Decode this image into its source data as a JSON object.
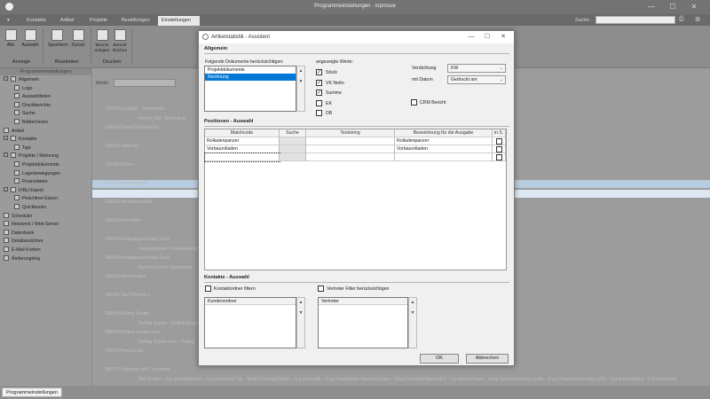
{
  "app": {
    "title": "Programmeinstellungen - inprosue"
  },
  "search": {
    "label": "Suche:"
  },
  "menu": {
    "tabs": [
      "Kontakte",
      "Artikel",
      "Projekte",
      "Bestellungen",
      "Einstellungen"
    ]
  },
  "ribbon": {
    "buttons": [
      "Alle",
      "Auswahl",
      "Speichern",
      "Zurück",
      "Bericht\nanlegen",
      "Bericht\nlöschen"
    ],
    "groups": [
      "Anzeige",
      "Bearbeiten",
      "Drucken"
    ]
  },
  "left": {
    "header": "Programmeinstellungen",
    "items": [
      {
        "label": "Allgemein",
        "level": 0,
        "expander": "⊟"
      },
      {
        "label": "Logo",
        "level": 1
      },
      {
        "label": "Auswahllisten",
        "level": 1
      },
      {
        "label": "Druckberichte",
        "level": 1
      },
      {
        "label": "Suche",
        "level": 1
      },
      {
        "label": "Bildrechnern",
        "level": 1
      },
      {
        "label": "Artikel",
        "level": 0
      },
      {
        "label": "Kontakte",
        "level": 0,
        "expander": "⊟"
      },
      {
        "label": "Tapi",
        "level": 1
      },
      {
        "label": "Projekte / Mahnung",
        "level": 0,
        "expander": "⊟"
      },
      {
        "label": "Projektdokumente",
        "level": 1
      },
      {
        "label": "Lagerbewegungen",
        "level": 1
      },
      {
        "label": "Finanzdaten",
        "level": 1
      },
      {
        "label": "FIBU Export",
        "level": 0,
        "expander": "⊟"
      },
      {
        "label": "Peachtree Export",
        "level": 1
      },
      {
        "label": "Quickbooks",
        "level": 1
      },
      {
        "label": "Scheduler",
        "level": 0
      },
      {
        "label": "Netzwerk / Web-Server",
        "level": 0
      },
      {
        "label": "Datenbank",
        "level": 0
      },
      {
        "label": "Detailansichten",
        "level": 0
      },
      {
        "label": "E-Mail Konten",
        "level": 0
      },
      {
        "label": "Änderungslog",
        "level": 0
      }
    ]
  },
  "main": {
    "modul_label": "Modul",
    "rows": [
      "100000   Kontakte - Telefonliste",
      "Permit_Kon_Telefonliste",
      "100100   Demo Druckbericht",
      "",
      "100200   Total Info",
      "",
      "100300   Demo",
      "",
      "200000   Artikelstatistik",
      "",
      "200100   Vorkaufsstatistik",
      "",
      "200200   Artikelliste",
      "",
      "300000   Fertigungsaufträge Serie",
      "Rundschlüssel Vorkaufsstatistik",
      "300100   Fertigungsaufträge Serie",
      "Rundschlüssel - Kabelsalat",
      "300200   Rechnungen",
      "",
      "300300   Text Themen 1",
      "",
      "300400   Rolling Shutter",
      "Rolling Shutter - Rolling Shutter",
      "300500   Rolling Shutter Inch",
      "Rolling Shutter Inch - Rolling",
      "300600   Projects list",
      "",
      "300700   Drawings and Cut sheets",
      "Roll Shutter - Cut sheets/Hinged - Cut sheets/Fin Tile - Shop Drawings/Gaffer - Cut sheets/Bl - Shop Drawings/Iv Sheets/Gordon - Shop Drawings/Backstitch - Cut sheets/Tower - Shop Drawings/Rocky Gulle - Shop Drawings/Security Grille - Cut sheets/Metal - Cut sheets/Lite"
    ]
  },
  "dialog": {
    "title": "Artikelstatistik - Assistent",
    "sections": {
      "general": "Allgemein",
      "positions": "Positionen - Auswahl",
      "contacts": "Kontakte - Auswahl"
    },
    "docs_label": "Folgende Dokumente berücksichtigen:",
    "docs": [
      "Projektdokumente",
      "Rechnung"
    ],
    "docs_selected": 1,
    "values_label": "angezeigte Werte:",
    "values": [
      {
        "label": "Stück",
        "checked": true
      },
      {
        "label": "VK Netto",
        "checked": true
      },
      {
        "label": "Summe",
        "checked": true
      },
      {
        "label": "EK",
        "checked": false
      },
      {
        "label": "DB",
        "checked": false
      }
    ],
    "verdichtung": {
      "label": "Verdichtung",
      "value": "KW"
    },
    "datum": {
      "label": "mit Datum",
      "value": "Gedruckt am"
    },
    "crm": {
      "label": "CRM Bericht",
      "checked": false
    },
    "grid": {
      "headers": [
        "Matchcode",
        "Suche",
        "Textstring",
        "Bezeichnung für die Ausgabe",
        "in S."
      ],
      "rows": [
        [
          "Rolladenpanzer",
          "",
          "",
          "Rolladenpanzer",
          ""
        ],
        [
          "Vorbaurolladen",
          "",
          "",
          "Vorbaurolladen",
          ""
        ],
        [
          "",
          "",
          "",
          "",
          ""
        ]
      ]
    },
    "kontaktordner": {
      "label": "Kontaktordner filtern",
      "checked": false,
      "list_header": "Kundenordner"
    },
    "vertreter": {
      "label": "Vertreter Filter berücksichtigen",
      "checked": false,
      "list_header": "Vertreter"
    },
    "ok_label": "OK",
    "cancel_label": "Abbrechen"
  },
  "status": {
    "tab": "Programmeinstellungen"
  }
}
